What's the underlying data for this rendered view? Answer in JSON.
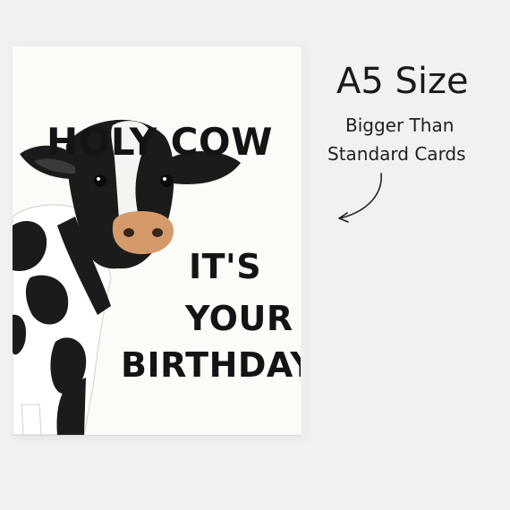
{
  "card": {
    "line1": "HOLY COW",
    "line2": "IT'S",
    "line3": "YOUR",
    "line4": "BIRTHDAY"
  },
  "size_info": {
    "title": "A5 Size",
    "subtitle_line1": "Bigger Than",
    "subtitle_line2": "Standard Cards"
  },
  "colors": {
    "background": "#f1f1f0",
    "card": "#fbfbf8",
    "text": "#141414",
    "cow_black": "#1b1b1b",
    "cow_nose": "#d49a6a"
  },
  "icons": {
    "pointer": "curved-arrow-icon",
    "illustration": "cow-illustration"
  }
}
